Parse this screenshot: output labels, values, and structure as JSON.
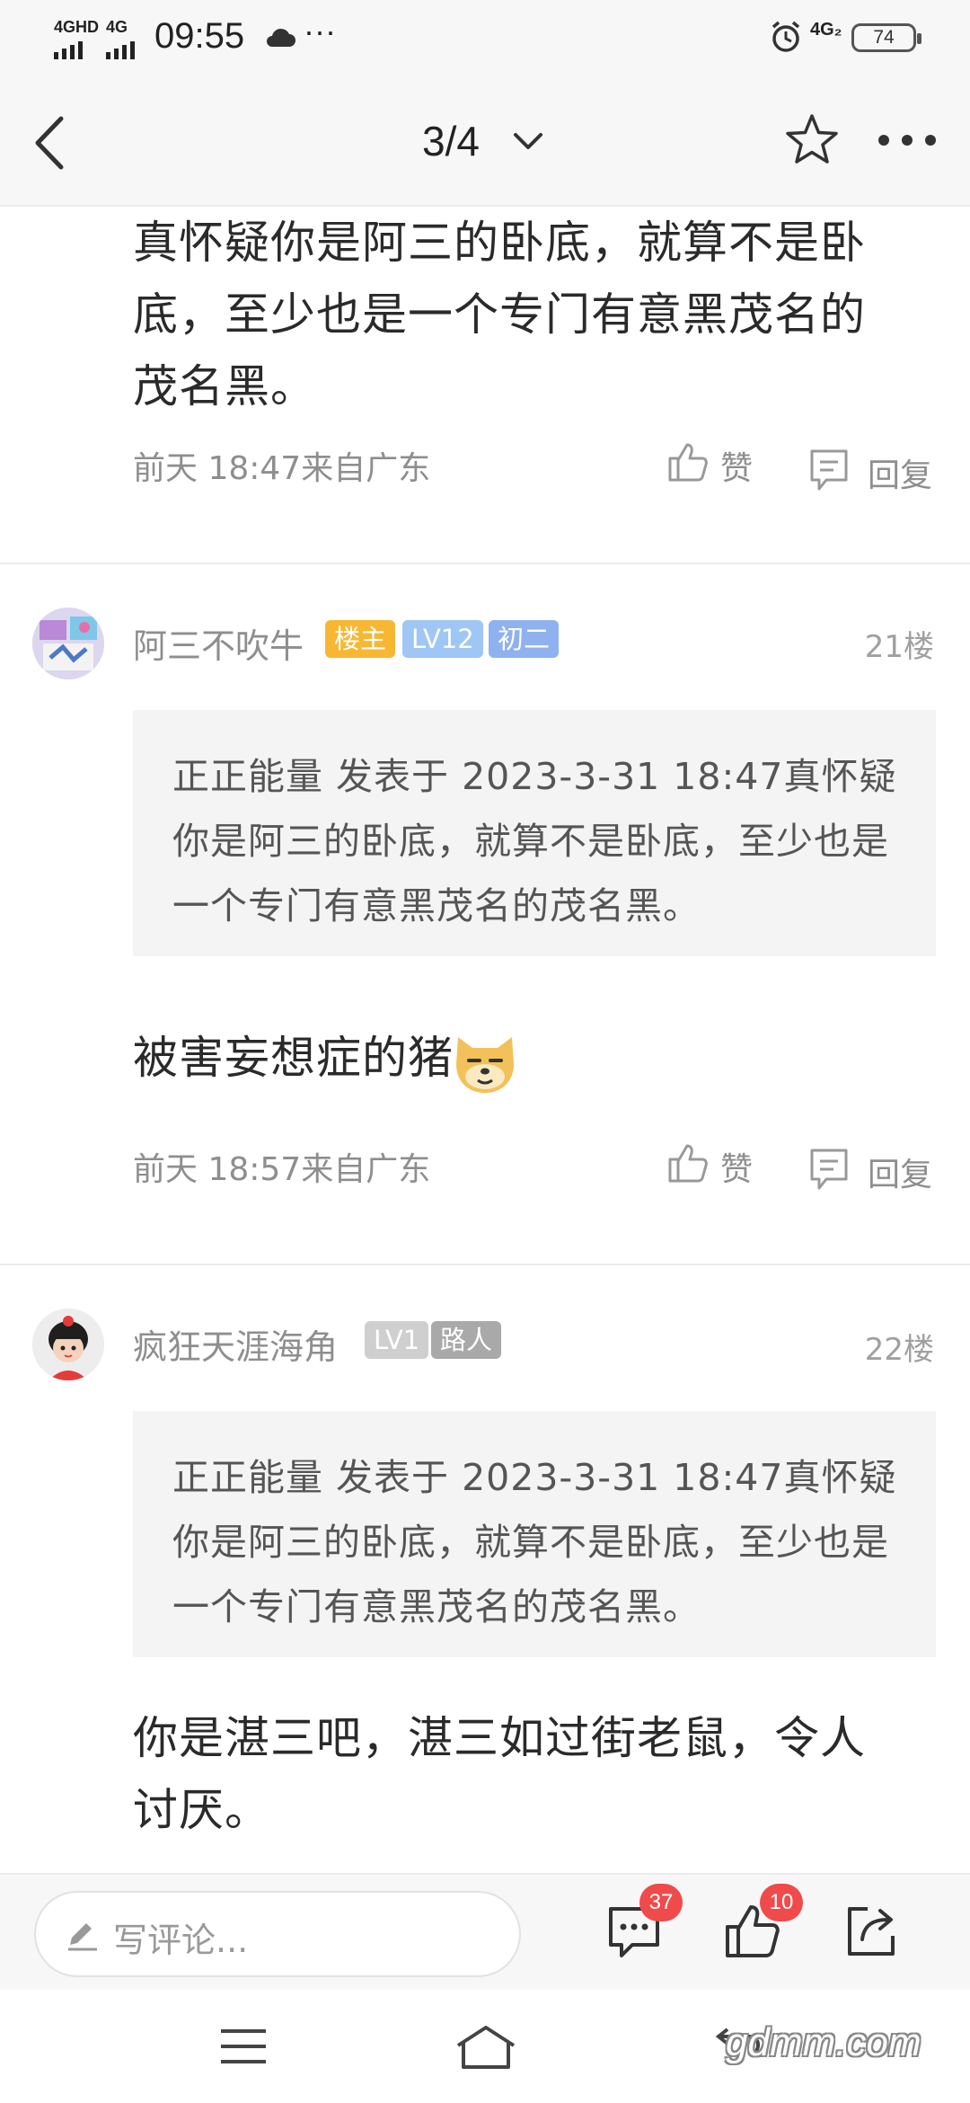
{
  "status_bar": {
    "net1": "4GHD",
    "net2": "4G",
    "time": "09:55",
    "dots": "···",
    "net3": "4G₂",
    "battery": "74"
  },
  "nav": {
    "page": "3/4"
  },
  "post_top": {
    "text": "真怀疑你是阿三的卧底，就算不是卧底，至少也是一个专门有意黑茂名的茂名黑。",
    "meta": "前天 18:47来自广东",
    "like_label": "赞",
    "reply_label": "回复"
  },
  "post_21": {
    "username": "阿三不吹牛",
    "badges": [
      "楼主",
      "LV12",
      "初二"
    ],
    "floor": "21楼",
    "quote": "正正能量 发表于 2023-3-31 18:47真怀疑你是阿三的卧底，就算不是卧底，至少也是一个专门有意黑茂名的茂名黑。",
    "text": "被害妄想症的猪",
    "meta": "前天 18:57来自广东",
    "like_label": "赞",
    "reply_label": "回复"
  },
  "post_22": {
    "username": "疯狂天涯海角",
    "badges": [
      "LV1",
      "路人"
    ],
    "floor": "22楼",
    "quote": "正正能量 发表于 2023-3-31 18:47真怀疑你是阿三的卧底，就算不是卧底，至少也是一个专门有意黑茂名的茂名黑。",
    "text": "你是湛三吧，湛三如过街老鼠，令人讨厌。"
  },
  "bottom_bar": {
    "placeholder": "写评论...",
    "comment_count": "37",
    "like_count": "10"
  },
  "watermark": "gdmm.com",
  "colors": {
    "badge_owner": "#f7b733",
    "badge_level": "#9fc6f5",
    "badge_grade": "#8fb1ef",
    "badge_grey": "#cfcfcf",
    "badge_grey_dark": "#a9a9a9",
    "count_red": "#f04a4a"
  }
}
